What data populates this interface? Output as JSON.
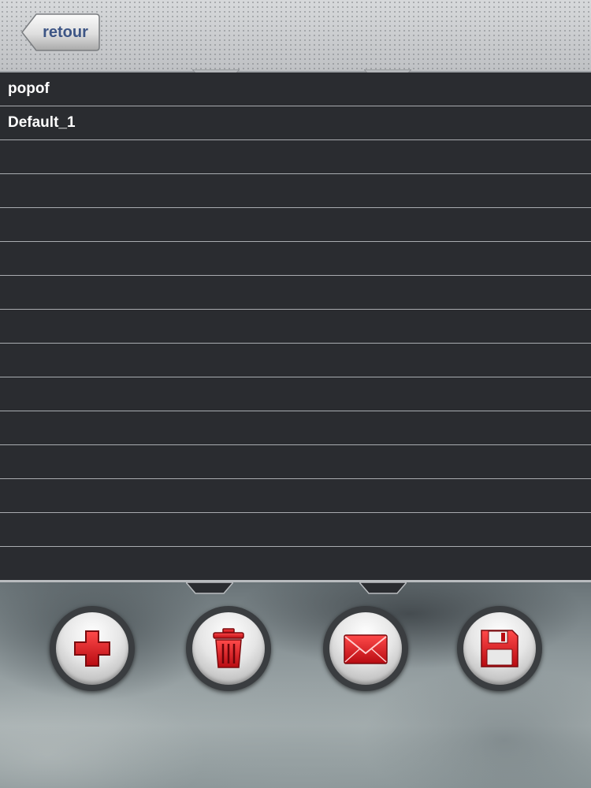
{
  "header": {
    "back_label": "retour"
  },
  "list": {
    "items": [
      {
        "label": "popof"
      },
      {
        "label": "Default_1"
      },
      {
        "label": ""
      },
      {
        "label": ""
      },
      {
        "label": ""
      },
      {
        "label": ""
      },
      {
        "label": ""
      },
      {
        "label": ""
      },
      {
        "label": ""
      },
      {
        "label": ""
      },
      {
        "label": ""
      },
      {
        "label": ""
      },
      {
        "label": ""
      },
      {
        "label": ""
      },
      {
        "label": ""
      }
    ]
  },
  "toolbar": {
    "buttons": [
      {
        "icon": "plus-icon"
      },
      {
        "icon": "trash-icon"
      },
      {
        "icon": "envelope-icon"
      },
      {
        "icon": "floppy-disk-icon"
      }
    ]
  },
  "colors": {
    "accent_red": "#d8141c",
    "back_text": "#3d5585",
    "list_bg": "#2a2c30",
    "divider": "#a9acb0"
  }
}
